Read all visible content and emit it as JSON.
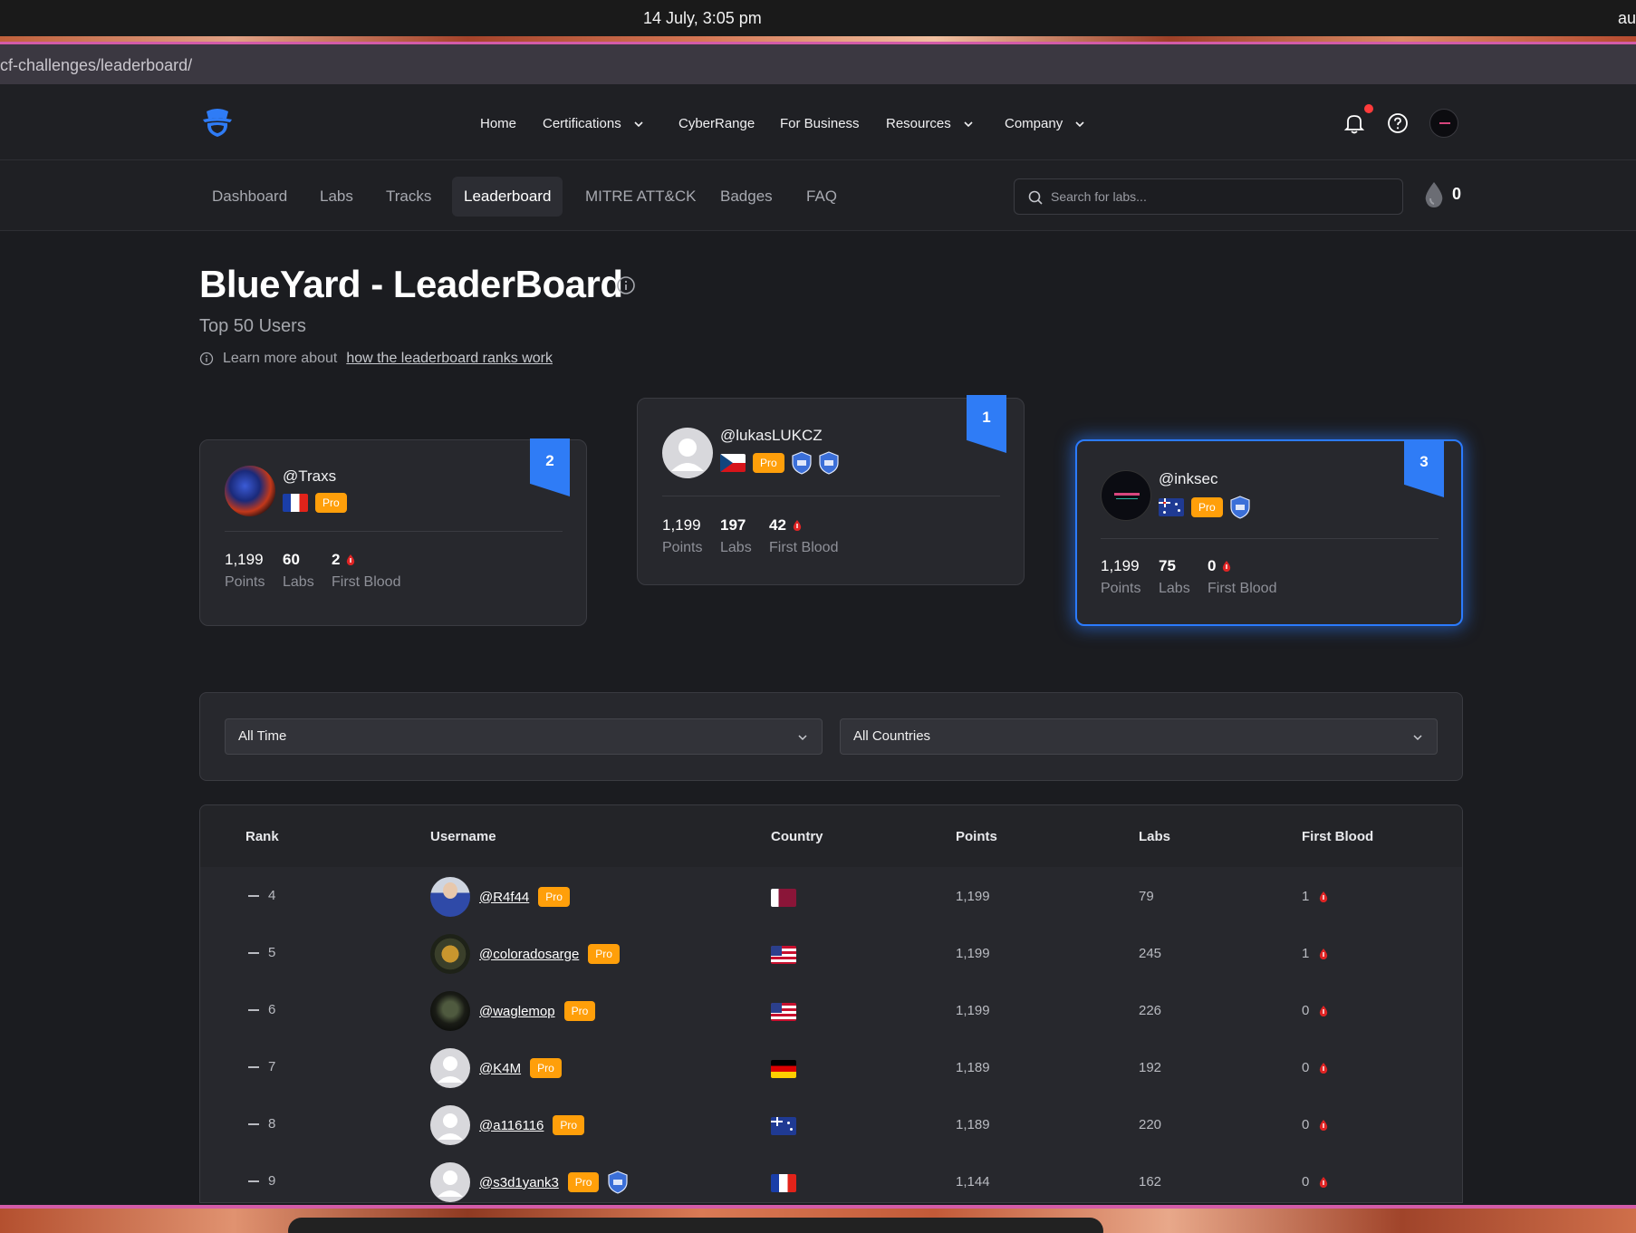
{
  "os": {
    "clock": "14 July, 3:05 pm",
    "right_text": "au"
  },
  "browser": {
    "url": "cf-challenges/leaderboard/"
  },
  "main_nav": {
    "items": [
      {
        "label": "Home",
        "dropdown": false
      },
      {
        "label": "Certifications",
        "dropdown": true
      },
      {
        "label": "CyberRange",
        "dropdown": false
      },
      {
        "label": "For Business",
        "dropdown": false
      },
      {
        "label": "Resources",
        "dropdown": true
      },
      {
        "label": "Company",
        "dropdown": true
      }
    ]
  },
  "sub_nav": {
    "tabs": [
      "Dashboard",
      "Labs",
      "Tracks",
      "Leaderboard",
      "MITRE ATT&CK",
      "Badges",
      "FAQ"
    ],
    "active": "Leaderboard",
    "search_placeholder": "Search for labs...",
    "drop_count": "0"
  },
  "header": {
    "title": "BlueYard - LeaderBoard",
    "subtitle": "Top 50 Users",
    "learn_prefix": "Learn more about",
    "learn_link": "how the leaderboard ranks work"
  },
  "podium": [
    {
      "rank": "2",
      "username": "@Traxs",
      "badge": "Pro",
      "points": "1,199",
      "labs": "60",
      "first_blood": "2",
      "labels": {
        "points": "Points",
        "labs": "Labs",
        "first_blood": "First Blood"
      }
    },
    {
      "rank": "1",
      "username": "@lukasLUKCZ",
      "badge": "Pro",
      "points": "1,199",
      "labs": "197",
      "first_blood": "42",
      "labels": {
        "points": "Points",
        "labs": "Labs",
        "first_blood": "First Blood"
      }
    },
    {
      "rank": "3",
      "username": "@inksec",
      "badge": "Pro",
      "points": "1,199",
      "labs": "75",
      "first_blood": "0",
      "labels": {
        "points": "Points",
        "labs": "Labs",
        "first_blood": "First Blood"
      }
    }
  ],
  "filters": {
    "period": "All Time",
    "country": "All Countries"
  },
  "table": {
    "columns": [
      "Rank",
      "Username",
      "Country",
      "Points",
      "Labs",
      "First Blood"
    ],
    "rows": [
      {
        "rank": "4",
        "username": "@R4f44",
        "badge": "Pro",
        "points": "1,199",
        "labs": "79",
        "first_blood": "1"
      },
      {
        "rank": "5",
        "username": "@coloradosarge",
        "badge": "Pro",
        "points": "1,199",
        "labs": "245",
        "first_blood": "1"
      },
      {
        "rank": "6",
        "username": "@waglemop",
        "badge": "Pro",
        "points": "1,199",
        "labs": "226",
        "first_blood": "0"
      },
      {
        "rank": "7",
        "username": "@K4M",
        "badge": "Pro",
        "points": "1,189",
        "labs": "192",
        "first_blood": "0"
      },
      {
        "rank": "8",
        "username": "@a116116",
        "badge": "Pro",
        "points": "1,189",
        "labs": "220",
        "first_blood": "0"
      },
      {
        "rank": "9",
        "username": "@s3d1yank3",
        "badge": "Pro",
        "points": "1,144",
        "labs": "162",
        "first_blood": "0"
      }
    ]
  }
}
